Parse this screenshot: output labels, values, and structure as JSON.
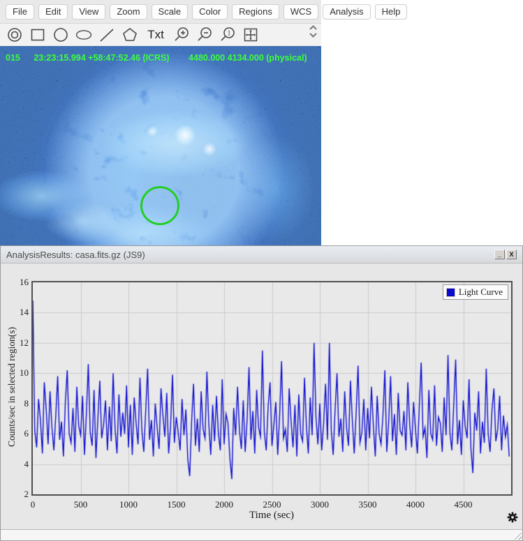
{
  "menu": {
    "items": [
      "File",
      "Edit",
      "View",
      "Zoom",
      "Scale",
      "Color",
      "Regions",
      "WCS",
      "Analysis",
      "Help"
    ]
  },
  "toolbar": {
    "text_tool_label": "Txt",
    "tools": [
      "annulus",
      "box",
      "circle",
      "ellipse",
      "line",
      "polygon",
      "text",
      "zoom-in",
      "zoom-out",
      "zoom-1",
      "pan"
    ]
  },
  "status": {
    "value": "015",
    "wcs": "23:23:15.994 +58:47:52.46 (ICRS)",
    "physical": "4480.000 4134.000 (physical)",
    "text_color": "#3dff3d"
  },
  "region": {
    "shape": "circle",
    "color": "#24cd24"
  },
  "dialog": {
    "title": "AnalysisResults: casa.fits.gz (JS9)",
    "minimize_label": "_",
    "close_label": "X"
  },
  "chart_data": {
    "type": "line",
    "title": "",
    "xlabel": "Time (sec)",
    "ylabel": "Counts/sec in selected region(s)",
    "legend": "Light Curve",
    "legend_position": "top-right",
    "grid": true,
    "series_color": "#0b0bd0",
    "grid_color": "#cbcbcb",
    "plot_bg": "#e9e9e9",
    "xlim": [
      0,
      5000
    ],
    "ylim": [
      2,
      16
    ],
    "xticks": [
      0,
      500,
      1000,
      1500,
      2000,
      2500,
      3000,
      3500,
      4000,
      4500
    ],
    "yticks": [
      2,
      4,
      6,
      8,
      10,
      12,
      14,
      16
    ],
    "t_start": 0,
    "t_step": 20,
    "values": [
      14.8,
      6.2,
      5.1,
      8.3,
      6.9,
      4.7,
      9.4,
      7.6,
      5.3,
      8.8,
      6.4,
      4.9,
      7.2,
      9.8,
      5.6,
      6.8,
      4.5,
      8.1,
      10.2,
      6.0,
      5.4,
      7.7,
      4.8,
      9.1,
      6.5,
      5.9,
      8.5,
      4.6,
      7.3,
      10.6,
      6.1,
      5.2,
      8.9,
      4.4,
      7.0,
      9.5,
      5.7,
      6.6,
      8.2,
      4.9,
      7.8,
      5.5,
      10.0,
      6.3,
      4.7,
      8.6,
      5.8,
      7.4,
      6.0,
      9.2,
      5.1,
      7.9,
      4.6,
      8.4,
      6.7,
      5.3,
      9.7,
      6.2,
      4.8,
      7.5,
      10.3,
      5.6,
      6.9,
      4.5,
      8.0,
      6.4,
      5.0,
      9.0,
      7.2,
      5.8,
      8.7,
      4.7,
      6.5,
      9.9,
      5.4,
      7.1,
      6.1,
      4.9,
      8.3,
      5.9,
      7.6,
      4.3,
      3.2,
      6.8,
      9.3,
      5.2,
      7.0,
      4.8,
      8.8,
      6.3,
      5.7,
      10.1,
      6.6,
      4.6,
      7.9,
      5.5,
      8.5,
      6.0,
      4.9,
      9.6,
      5.3,
      7.3,
      6.7,
      4.4,
      3.0,
      7.7,
      5.9,
      9.1,
      6.2,
      5.0,
      8.2,
      4.8,
      6.9,
      10.4,
      5.6,
      7.5,
      4.7,
      8.9,
      6.4,
      5.8,
      11.5,
      6.1,
      4.9,
      7.8,
      9.4,
      5.2,
      6.6,
      8.1,
      4.6,
      7.2,
      10.8,
      5.7,
      6.3,
      4.8,
      9.0,
      6.8,
      5.1,
      7.9,
      4.5,
      8.6,
      6.0,
      5.5,
      9.7,
      6.5,
      4.7,
      8.4,
      5.9,
      12.0,
      7.1,
      5.3,
      8.0,
      4.9,
      6.7,
      9.3,
      5.6,
      12.0,
      6.2,
      4.6,
      7.6,
      10.0,
      5.8,
      7.0,
      4.8,
      8.8,
      6.4,
      5.2,
      9.5,
      6.9,
      4.7,
      7.4,
      10.5,
      5.4,
      6.1,
      8.3,
      4.9,
      7.7,
      5.7,
      9.1,
      6.5,
      4.5,
      8.5,
      6.0,
      5.3,
      7.2,
      10.2,
      4.8,
      6.8,
      9.8,
      5.5,
      7.3,
      4.6,
      8.7,
      6.2,
      5.9,
      7.5,
      4.9,
      9.4,
      6.6,
      5.1,
      8.1,
      6.3,
      4.7,
      7.8,
      10.7,
      5.8,
      6.4,
      4.4,
      8.9,
      6.0,
      5.6,
      9.2,
      5.2,
      7.1,
      6.7,
      4.8,
      8.4,
      5.9,
      11.2,
      6.1,
      4.9,
      7.9,
      10.9,
      5.3,
      6.9,
      4.6,
      8.2,
      6.5,
      5.7,
      9.6,
      5.0,
      3.4,
      7.4,
      6.2,
      8.8,
      4.7,
      6.8,
      5.4,
      10.3,
      6.0,
      4.8,
      7.6,
      9.0,
      5.5,
      6.3,
      8.5,
      4.9,
      7.2,
      5.8,
      6.6,
      4.5
    ]
  }
}
